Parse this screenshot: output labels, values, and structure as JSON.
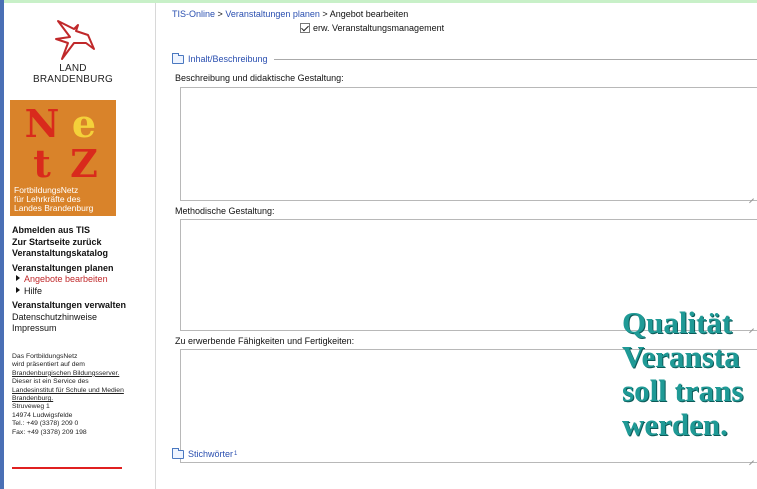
{
  "sidebar": {
    "brand": {
      "line1": "LAND",
      "line2": "BRANDENBURG"
    },
    "netz_logo": {
      "letters": [
        "N",
        "e",
        "t",
        "Z"
      ],
      "caption": [
        "FortbildungsNetz",
        "für Lehrkräfte des",
        "Landes Brandenburg"
      ]
    },
    "nav": {
      "abmelden": "Abmelden aus TIS",
      "startseite": "Zur Startseite zurück",
      "katalog": "Veranstaltungskatalog",
      "planen": "Veranstaltungen planen",
      "angebote": "Angebote bearbeiten",
      "hilfe": "Hilfe",
      "verwalten": "Veranstaltungen verwalten",
      "datenschutz": "Datenschutzhinweise",
      "impressum": "Impressum"
    },
    "info": {
      "l1": "Das FortbildungsNetz",
      "l2": "wird präsentiert auf dem",
      "l3": "Brandenburgischen Bildungsserver.",
      "l4": "Dieser ist ein Service des",
      "l5": "Landesinstitut für Schule und Medien",
      "l6": "Brandenburg.",
      "l7": "Struveweg 1",
      "l8": "14974 Ludwigsfelde",
      "l9": "Tel.: +49 (3378) 209 0",
      "l10": "Fax: +49 (3378) 209 198"
    }
  },
  "main": {
    "breadcrumb": {
      "item1": "TIS-Online",
      "sep": ">",
      "item2": "Veranstaltungen planen",
      "item3": "Angebot bearbeiten"
    },
    "checkbox_label": "erw. Veranstaltungsmanagement",
    "section_title": "Inhalt/Beschreibung",
    "fields": {
      "beschreibung": "Beschreibung und didaktische Gestaltung:",
      "methodisch": "Methodische Gestaltung:",
      "faehigkeiten": "Zu erwerbende Fähigkeiten und Fertigkeiten:"
    },
    "stichwoerter": {
      "label": "Stichwörter",
      "sup": "1"
    }
  },
  "overlay": {
    "line1": "Qualität",
    "line2": "Veransta",
    "line3": "soll trans",
    "line4": "werden."
  },
  "colors": {
    "link": "#2a4fb0",
    "active": "#c0282a",
    "overlay": "#1f9a96",
    "netz_bg": "#d9832a",
    "netz_letters": "#d92a1c"
  }
}
